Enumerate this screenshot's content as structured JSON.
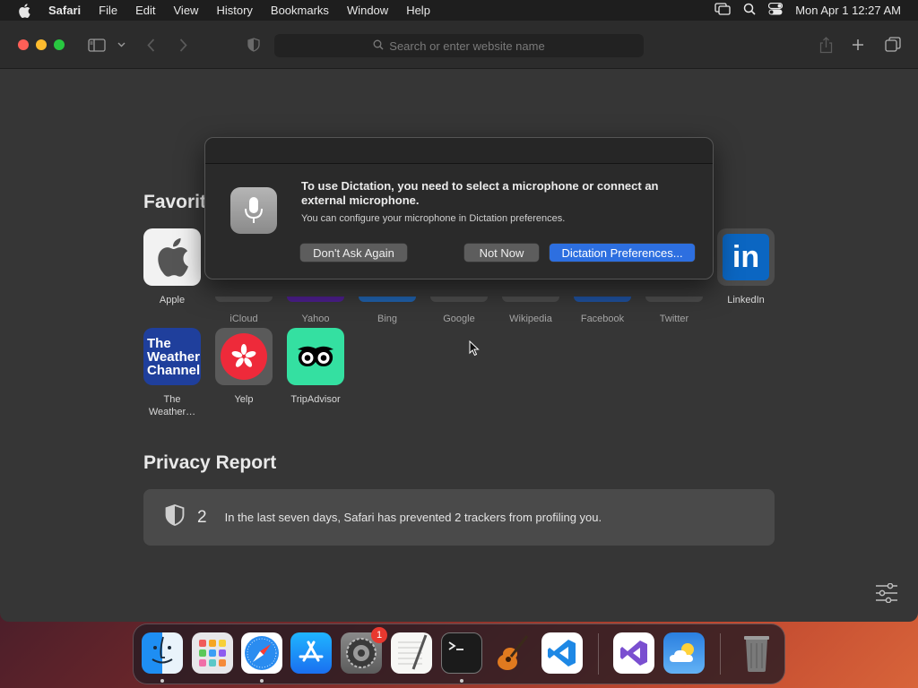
{
  "menubar": {
    "app_name": "Safari",
    "items": [
      "File",
      "Edit",
      "View",
      "History",
      "Bookmarks",
      "Window",
      "Help"
    ],
    "clock": "Mon Apr 1  12:27 AM"
  },
  "toolbar": {
    "search_placeholder": "Search or enter website name"
  },
  "favorites": {
    "title": "Favorites",
    "items": [
      {
        "label": "Apple"
      },
      {
        "label": "iCloud"
      },
      {
        "label": "Yahoo"
      },
      {
        "label": "Bing"
      },
      {
        "label": "Google"
      },
      {
        "label": "Wikipedia"
      },
      {
        "label": "Facebook"
      },
      {
        "label": "Twitter"
      },
      {
        "label": "LinkedIn",
        "tile_text": "in"
      },
      {
        "label": "The Weather…",
        "label_line1": "The",
        "label_line2": "Weather…",
        "tile_lines": [
          "The",
          "Weather",
          "Channel"
        ]
      },
      {
        "label": "Yelp"
      },
      {
        "label": "TripAdvisor"
      }
    ]
  },
  "privacy": {
    "title": "Privacy Report",
    "count": "2",
    "text": "In the last seven days, Safari has prevented 2 trackers from profiling you."
  },
  "dialog": {
    "title": "To use Dictation, you need to select a microphone or connect an external microphone.",
    "subtitle": "You can configure your microphone in Dictation preferences.",
    "buttons": {
      "dont_ask": "Don't Ask Again",
      "not_now": "Not Now",
      "preferences": "Dictation Preferences..."
    }
  },
  "dock": {
    "apps": [
      "finder",
      "launchpad",
      "safari",
      "app-store",
      "system-preferences",
      "textedit",
      "terminal",
      "garageband",
      "vscode",
      "visual-studio",
      "weather",
      "trash"
    ],
    "system_preferences_badge": "1"
  },
  "colors": {
    "accent": "#2d6fe0",
    "window_bg": "#363636",
    "badge": "#e8382f"
  }
}
